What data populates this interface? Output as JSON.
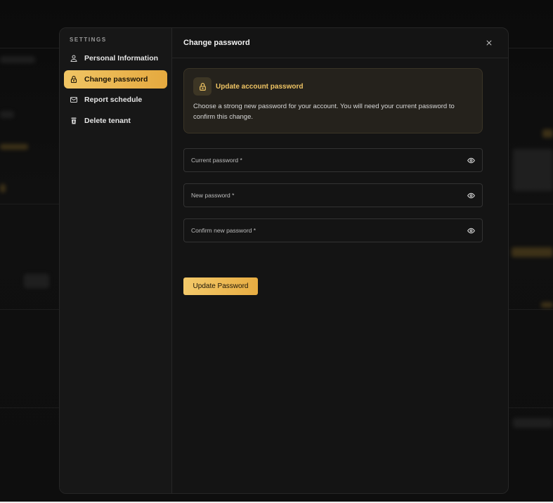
{
  "sidebar": {
    "heading": "SETTINGS",
    "items": [
      {
        "label": "Personal Information",
        "icon": "user-icon",
        "active": false
      },
      {
        "label": "Change password",
        "icon": "lock-icon",
        "active": true
      },
      {
        "label": "Report schedule",
        "icon": "mail-icon",
        "active": false
      },
      {
        "label": "Delete tenant",
        "icon": "trash-icon",
        "active": false
      }
    ]
  },
  "main": {
    "title": "Change password",
    "close_icon": "close-icon",
    "info": {
      "icon": "lock-icon",
      "title": "Update account password",
      "text": "Choose a strong new password for your account. You will need your current password to confirm this change."
    },
    "fields": [
      {
        "placeholder": "Current password *",
        "value": "",
        "icon": "eye-icon"
      },
      {
        "placeholder": "New password *",
        "value": "",
        "icon": "eye-icon"
      },
      {
        "placeholder": "Confirm new password *",
        "value": "",
        "icon": "eye-icon"
      }
    ],
    "submit_label": "Update Password"
  },
  "colors": {
    "accent": "#f0c564",
    "background": "#141414",
    "sidebar": "#171717",
    "info_card": "#25221c"
  }
}
